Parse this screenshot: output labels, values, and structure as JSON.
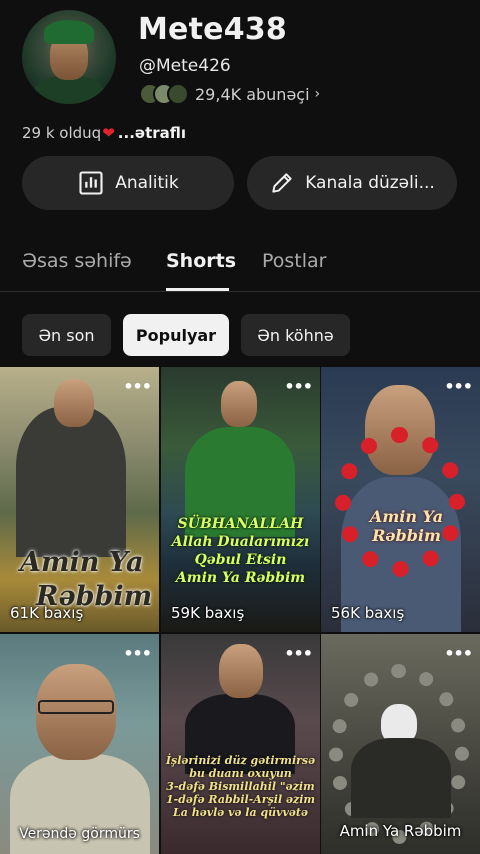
{
  "channel": {
    "name": "Mete438",
    "handle": "@Mete426",
    "subscribers": "29,4K abunəçi",
    "description": "29 k olduq",
    "description_more": "...ətraflı"
  },
  "actions": {
    "analytics_label": "Analitik",
    "edit_label": "Kanala düzəli..."
  },
  "tabs": [
    {
      "label": "Əsas səhifə",
      "active": false
    },
    {
      "label": "Shorts",
      "active": true
    },
    {
      "label": "Postlar",
      "active": false
    }
  ],
  "filters": [
    {
      "label": "Ən son",
      "selected": false
    },
    {
      "label": "Populyar",
      "selected": true
    },
    {
      "label": "Ən köhnə",
      "selected": false
    }
  ],
  "shorts": [
    {
      "views": "61K baxış",
      "overlay": "Amin Ya Rəbbim"
    },
    {
      "views": "59K baxış",
      "overlay": [
        "SÜBHANALLAH",
        "Allah Dualarımızı",
        "Qəbul Etsin",
        "Amin Ya Rəbbim"
      ]
    },
    {
      "views": "56K baxış",
      "overlay": "Amin Ya Rəbbim"
    },
    {
      "title": "Verəndə görmürs"
    },
    {
      "overlay": [
        "İşlərinizi düz gətirmirsə",
        "bu duanı oxuyun",
        "3-dəfə Bismillahil \"əzim",
        "1-dəfə Rabbil-Arşil əzim",
        "La həvlə və la qüvvətə"
      ]
    },
    {
      "title": "Amin Ya Rəbbim"
    }
  ],
  "colors": {
    "background": "#0f0f0f",
    "chip_selected": "#f1f1f1",
    "button_bg": "#272727",
    "heart": "#e0242e"
  }
}
